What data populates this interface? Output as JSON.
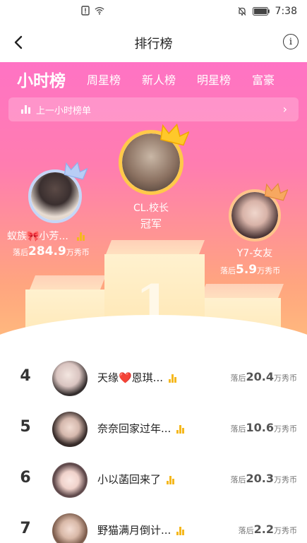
{
  "status_bar": {
    "time": "7:38"
  },
  "nav": {
    "title": "排行榜",
    "info_glyph": "i"
  },
  "tabs": [
    {
      "label": "小时榜",
      "active": true
    },
    {
      "label": "周星榜",
      "active": false
    },
    {
      "label": "新人榜",
      "active": false
    },
    {
      "label": "明星榜",
      "active": false
    },
    {
      "label": "富豪",
      "active": false
    }
  ],
  "last_hour": {
    "label": "上一小时榜单",
    "arrow": "›"
  },
  "podium": {
    "first": {
      "name": "CL.校长",
      "title": "冠军"
    },
    "second": {
      "name": "蚁族🎀小芳...",
      "behind_prefix": "落后",
      "behind_value": "284.9",
      "behind_unit": "万秀币"
    },
    "third": {
      "name": "Y7-女友",
      "behind_prefix": "落后",
      "behind_value": "5.9",
      "behind_unit": "万秀币"
    }
  },
  "ranking": [
    {
      "rank": "4",
      "name": "天缘❤️恩琪...",
      "behind_prefix": "落后",
      "behind_value": "20.4",
      "behind_unit": "万秀币"
    },
    {
      "rank": "5",
      "name": "奈奈回家过年...",
      "behind_prefix": "落后",
      "behind_value": "10.6",
      "behind_unit": "万秀币"
    },
    {
      "rank": "6",
      "name": "小以菡回来了",
      "behind_prefix": "落后",
      "behind_value": "20.3",
      "behind_unit": "万秀币"
    },
    {
      "rank": "7",
      "name": "野猫满月倒计...",
      "behind_prefix": "落后",
      "behind_value": "2.2",
      "behind_unit": "万秀币"
    }
  ],
  "icons": {
    "back": "chevron-left-icon",
    "info": "info-icon",
    "crown": "crown-icon",
    "level": "level-bars-icon"
  },
  "colors": {
    "hero_top": "#ff73c4",
    "hero_bottom": "#ffc07d",
    "gold": "#f5b81e",
    "silver_crown": "#a9c4f2",
    "bronze_crown": "#f5a35b"
  }
}
